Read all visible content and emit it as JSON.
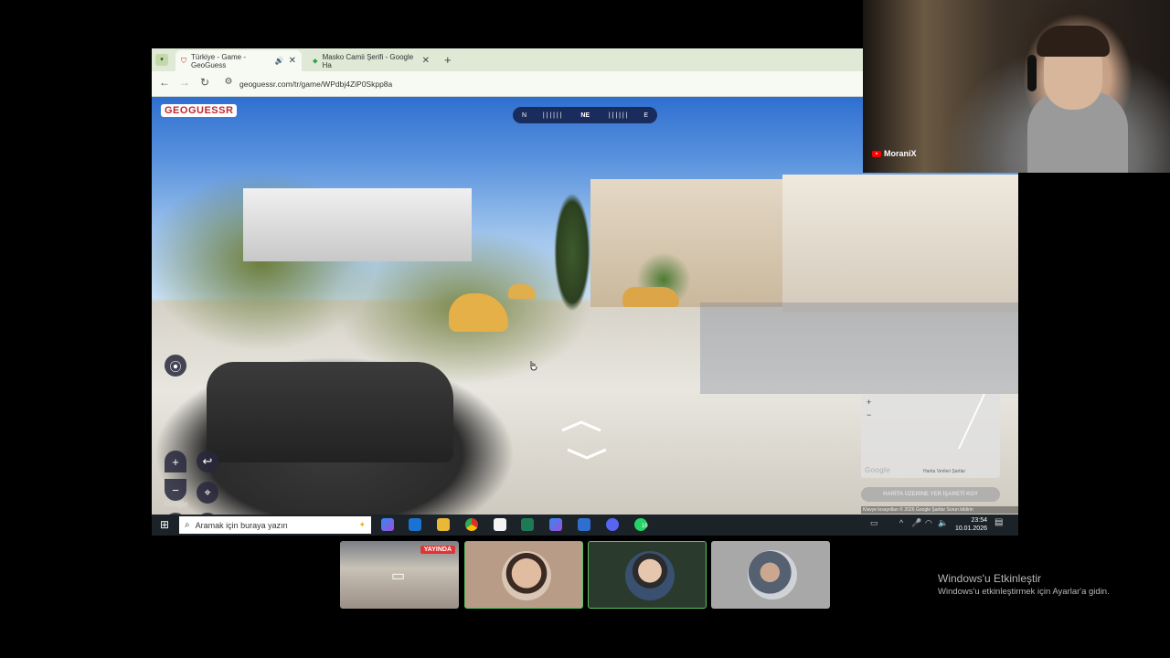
{
  "browser": {
    "tabs": [
      {
        "title": "Türkiye - Game - GeoGuess",
        "close": "✕"
      },
      {
        "title": "Masko Camii Şerifi - Google Ha",
        "close": "✕"
      }
    ],
    "new_tab": "+",
    "url": "geoguessr.com/tr/game/WPdbj4ZiP0Skpp8a"
  },
  "game": {
    "logo": "GEOGUESSR",
    "compass": {
      "left": "N",
      "center": "NE",
      "right": "E"
    },
    "minimap_footer": "Klavye kısayolları  © 2026 Google  Şartlar  Sorun bildirin",
    "map_attrib": "Harita Verileri  Şartlar",
    "guess_button": "HARİTA ÜZERİNE YER İŞARETİ KOY",
    "watermark": "Google"
  },
  "taskbar": {
    "search_placeholder": "Aramak için buraya yazın",
    "time": "23:54",
    "date": "10.01.2026",
    "whatsapp_badge": "19"
  },
  "webcam": {
    "channel": "MoraniX"
  },
  "participants": {
    "live_label": "YAYINDA"
  },
  "windows": {
    "activate_title": "Windows'u Etkinleştir",
    "activate_sub": "Windows'u etkinleştirmek için Ayarlar'a gidin."
  }
}
